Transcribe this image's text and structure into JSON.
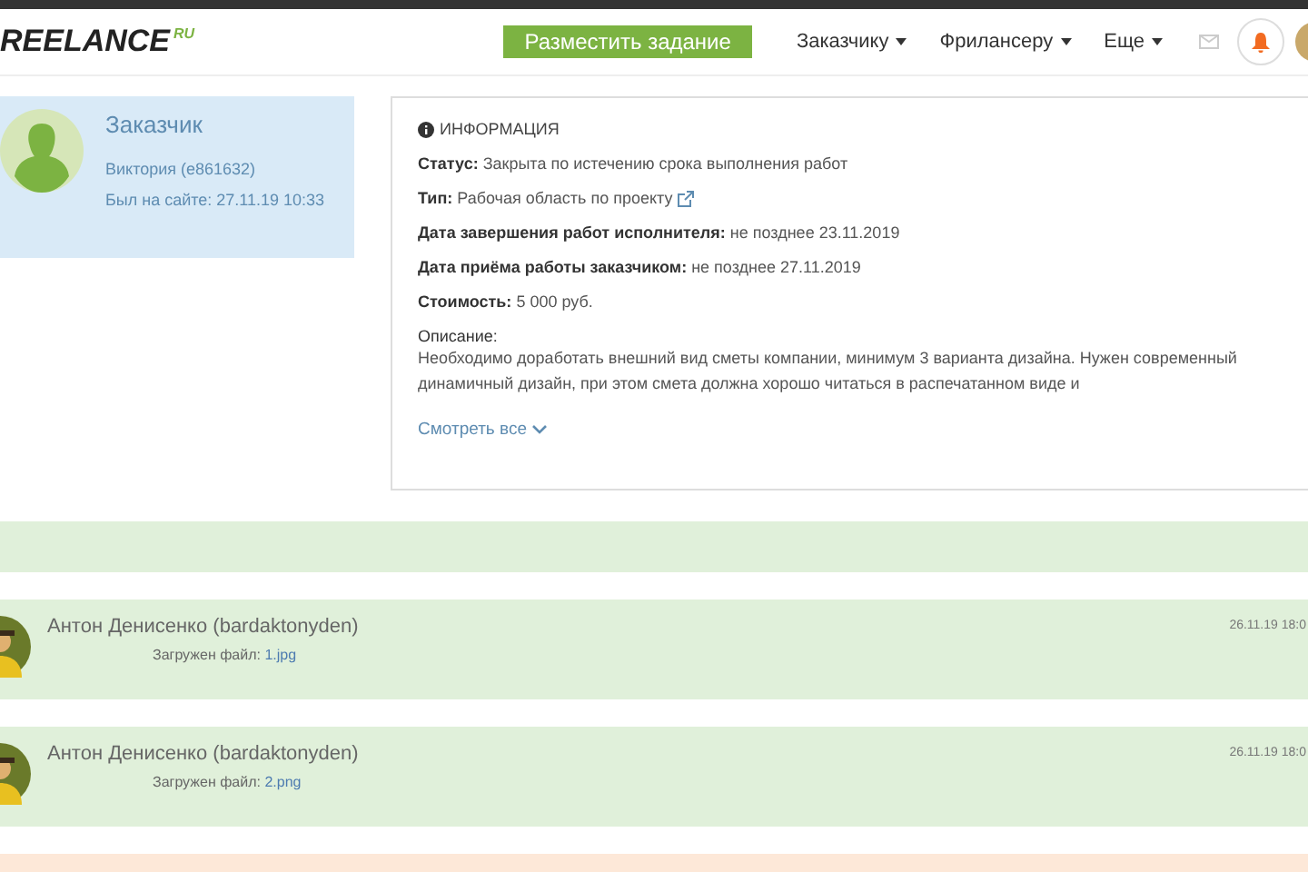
{
  "header": {
    "logo": {
      "text": "REELANCE",
      "suffix": "RU"
    },
    "post_button": "Разместить задание",
    "menu": [
      {
        "label": "Заказчику"
      },
      {
        "label": "Фрилансеру"
      },
      {
        "label": "Еще"
      }
    ]
  },
  "customer": {
    "title": "Заказчик",
    "name": "Виктория (e861632)",
    "last_seen": "Был на сайте: 27.11.19 10:33"
  },
  "info": {
    "heading": "ИНФОРМАЦИЯ",
    "fields": [
      {
        "text": "**Статус:** Закрыта по истечению срока выполнения работ",
        "link": false
      },
      {
        "text": "**Тип:** Рабочая область по проекту",
        "link": true
      },
      {
        "text": "**Дата завершения работ исполнителя:** не позднее 23.11.2019",
        "link": false
      },
      {
        "text": "**Дата приёма работы заказчиком:** не позднее 27.11.2019",
        "link": false
      },
      {
        "text": "**Стоимость:** 5 000 руб.",
        "link": false
      }
    ],
    "description_label": "Описание:",
    "description": "Необходимо доработать внешний вид сметы компании, минимум 3 варианта дизайна. Нужен современный динамичный дизайн, при этом смета должна хорошо читаться в распечатанном виде и",
    "show_all": "Смотреть все"
  },
  "messages": [
    {
      "author": "Антон Денисенко (bardaktonyden)",
      "file_label": "Загружен файл:",
      "file": "1.jpg",
      "time": "26.11.19 18:0"
    },
    {
      "author": "Антон Денисенко (bardaktonyden)",
      "file_label": "Загружен файл:",
      "file": "2.png",
      "time": "26.11.19 18:0"
    }
  ]
}
